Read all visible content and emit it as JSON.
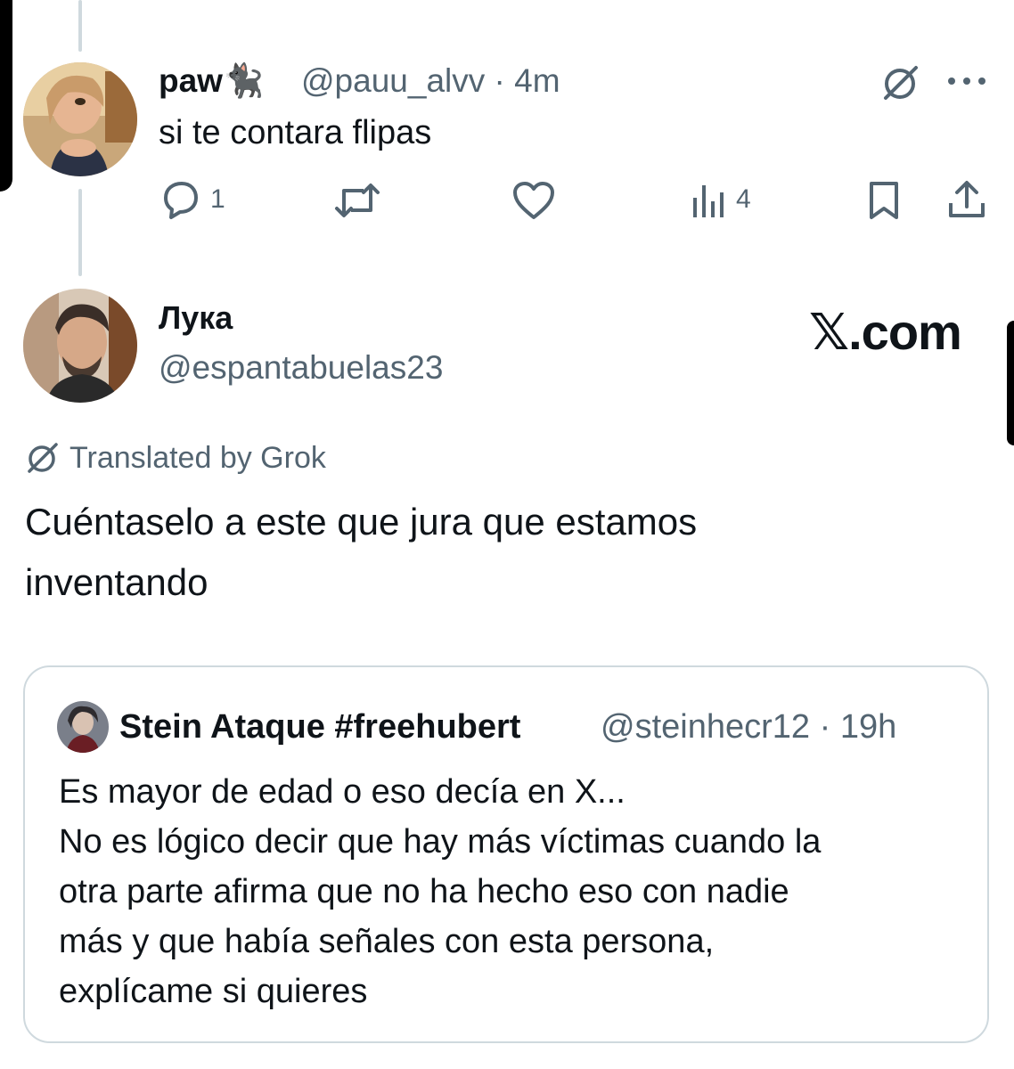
{
  "reply_tweet": {
    "display_name": "paw🐈‍⬛",
    "handle": "@pauu_alvv",
    "separator": "·",
    "time": "4m",
    "text": "si te contara flipas",
    "actions": {
      "reply_count": "1",
      "repost_count": "",
      "like_count": "",
      "views_count": "4"
    },
    "icons": [
      "grok-translate-icon",
      "more-icon",
      "reply-icon",
      "repost-icon",
      "like-icon",
      "views-icon",
      "bookmark-icon",
      "share-icon"
    ]
  },
  "main_tweet": {
    "display_name": "Лука",
    "handle": "@espantabuelas23",
    "watermark": "𝕏.com",
    "translated_label": "Translated by Grok",
    "text_lines": [
      "Cuéntaselo a este que jura que estamos",
      "inventando"
    ]
  },
  "quoted_tweet": {
    "display_name": "Stein Ataque #freehubert",
    "handle": "@steinhecr12",
    "separator": "·",
    "time": "19h",
    "text_lines": [
      "Es mayor de edad o eso decía en X...",
      "No es lógico decir que hay más víctimas cuando la",
      "otra parte afirma que no ha hecho eso con nadie",
      "más y que había señales con esta persona,",
      "explícame si quieres"
    ]
  },
  "colors": {
    "text_primary": "#0f1419",
    "text_secondary": "#536471",
    "border": "#cfd9de",
    "background": "#ffffff"
  }
}
